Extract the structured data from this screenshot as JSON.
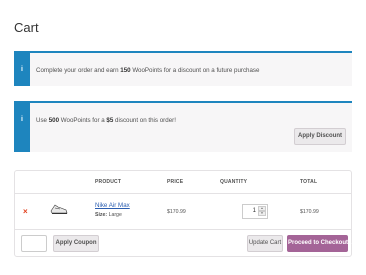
{
  "page": {
    "title": "Cart"
  },
  "notices": {
    "points_earn": {
      "pre": "Complete your order and earn ",
      "points": "150",
      "post": " WooPoints for a discount on a future purchase"
    },
    "points_redeem": {
      "pre": "Use ",
      "points": "500",
      "mid": " WooPoints for a ",
      "amount": "$5",
      "post": " discount on this order!",
      "button": "Apply Discount"
    }
  },
  "cart": {
    "headers": {
      "product": "PRODUCT",
      "price": "PRICE",
      "quantity": "QUANTITY",
      "total": "TOTAL"
    },
    "items": [
      {
        "remove": "×",
        "name": "Nike Air Max",
        "meta_label": "Size:",
        "meta_value": "Large",
        "price": "$170.99",
        "quantity": "1",
        "subtotal": "$170.99"
      }
    ],
    "actions": {
      "apply_coupon": "Apply Coupon",
      "update_cart": "Update Cart",
      "checkout": "Proceed to Checkout →"
    }
  },
  "colors": {
    "accent": "#1e85be",
    "checkout": "#a46497",
    "remove": "#e2401c"
  }
}
